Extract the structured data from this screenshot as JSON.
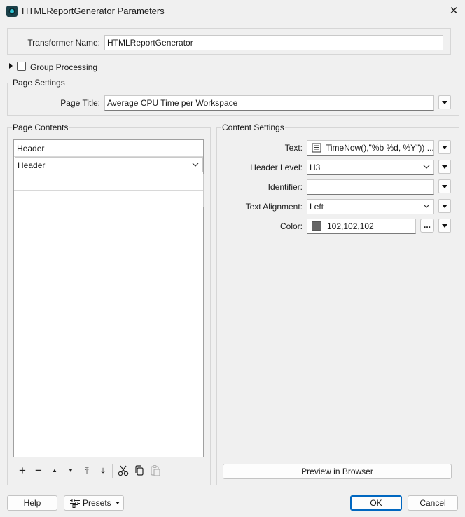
{
  "window": {
    "title": "HTMLReportGenerator Parameters",
    "close_glyph": "✕"
  },
  "transformer": {
    "label": "Transformer Name:",
    "value": "HTMLReportGenerator"
  },
  "group_processing": {
    "label": "Group Processing",
    "checked": false
  },
  "page_settings": {
    "legend": "Page Settings",
    "page_title_label": "Page Title:",
    "page_title_value": "Average CPU Time per Workspace"
  },
  "page_contents": {
    "legend": "Page Contents",
    "header_field": "Header",
    "selected_type": "Header"
  },
  "content_settings": {
    "legend": "Content Settings",
    "text_label": "Text:",
    "text_value": "TimeNow(),\"%b %d, %Y\")) ...",
    "header_level_label": "Header Level:",
    "header_level_value": "H3",
    "identifier_label": "Identifier:",
    "identifier_value": "",
    "alignment_label": "Text Alignment:",
    "alignment_value": "Left",
    "color_label": "Color:",
    "color_value": "102,102,102",
    "color_swatch": "#666666",
    "ellipsis": "...",
    "preview_button": "Preview in Browser"
  },
  "toolbar": {
    "add": "+",
    "remove": "−",
    "move_up": "▲",
    "move_down": "▼",
    "move_top": "⤒",
    "move_bottom": "⤓"
  },
  "footer": {
    "help": "Help",
    "presets": "Presets",
    "ok": "OK",
    "cancel": "Cancel"
  }
}
